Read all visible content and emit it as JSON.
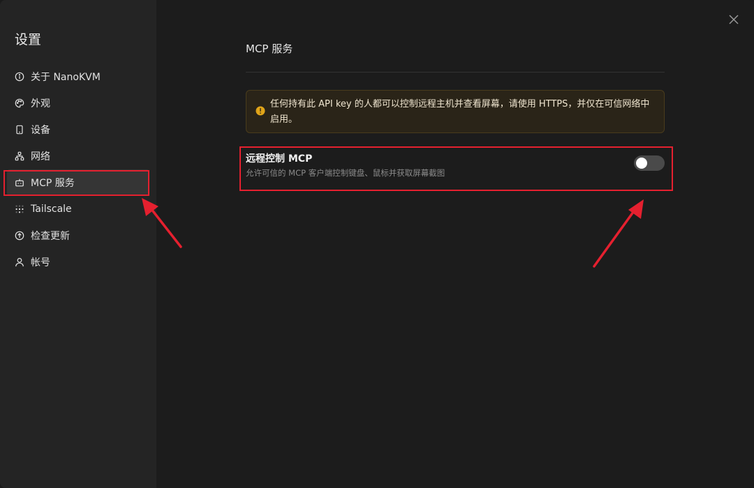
{
  "sidebar": {
    "title": "设置",
    "items": [
      {
        "label": "关于 NanoKVM",
        "icon": "info-icon"
      },
      {
        "label": "外观",
        "icon": "palette-icon"
      },
      {
        "label": "设备",
        "icon": "device-icon"
      },
      {
        "label": "网络",
        "icon": "network-icon"
      },
      {
        "label": "MCP 服务",
        "icon": "bot-icon",
        "active": true
      },
      {
        "label": "Tailscale",
        "icon": "tailscale-icon"
      },
      {
        "label": "检查更新",
        "icon": "update-icon"
      },
      {
        "label": "帐号",
        "icon": "user-icon"
      }
    ]
  },
  "main": {
    "title": "MCP 服务",
    "warning": "任何持有此 API key 的人都可以控制远程主机并查看屏幕，请使用 HTTPS，并仅在可信网络中启用。",
    "setting": {
      "title": "远程控制 MCP",
      "description": "允许可信的 MCP 客户端控制键盘、鼠标并获取屏幕截图",
      "enabled": false
    }
  },
  "colors": {
    "highlight": "#e5202f",
    "warning_icon": "#e0a419",
    "sidebar_bg": "#242424",
    "content_bg": "#1c1c1c"
  }
}
